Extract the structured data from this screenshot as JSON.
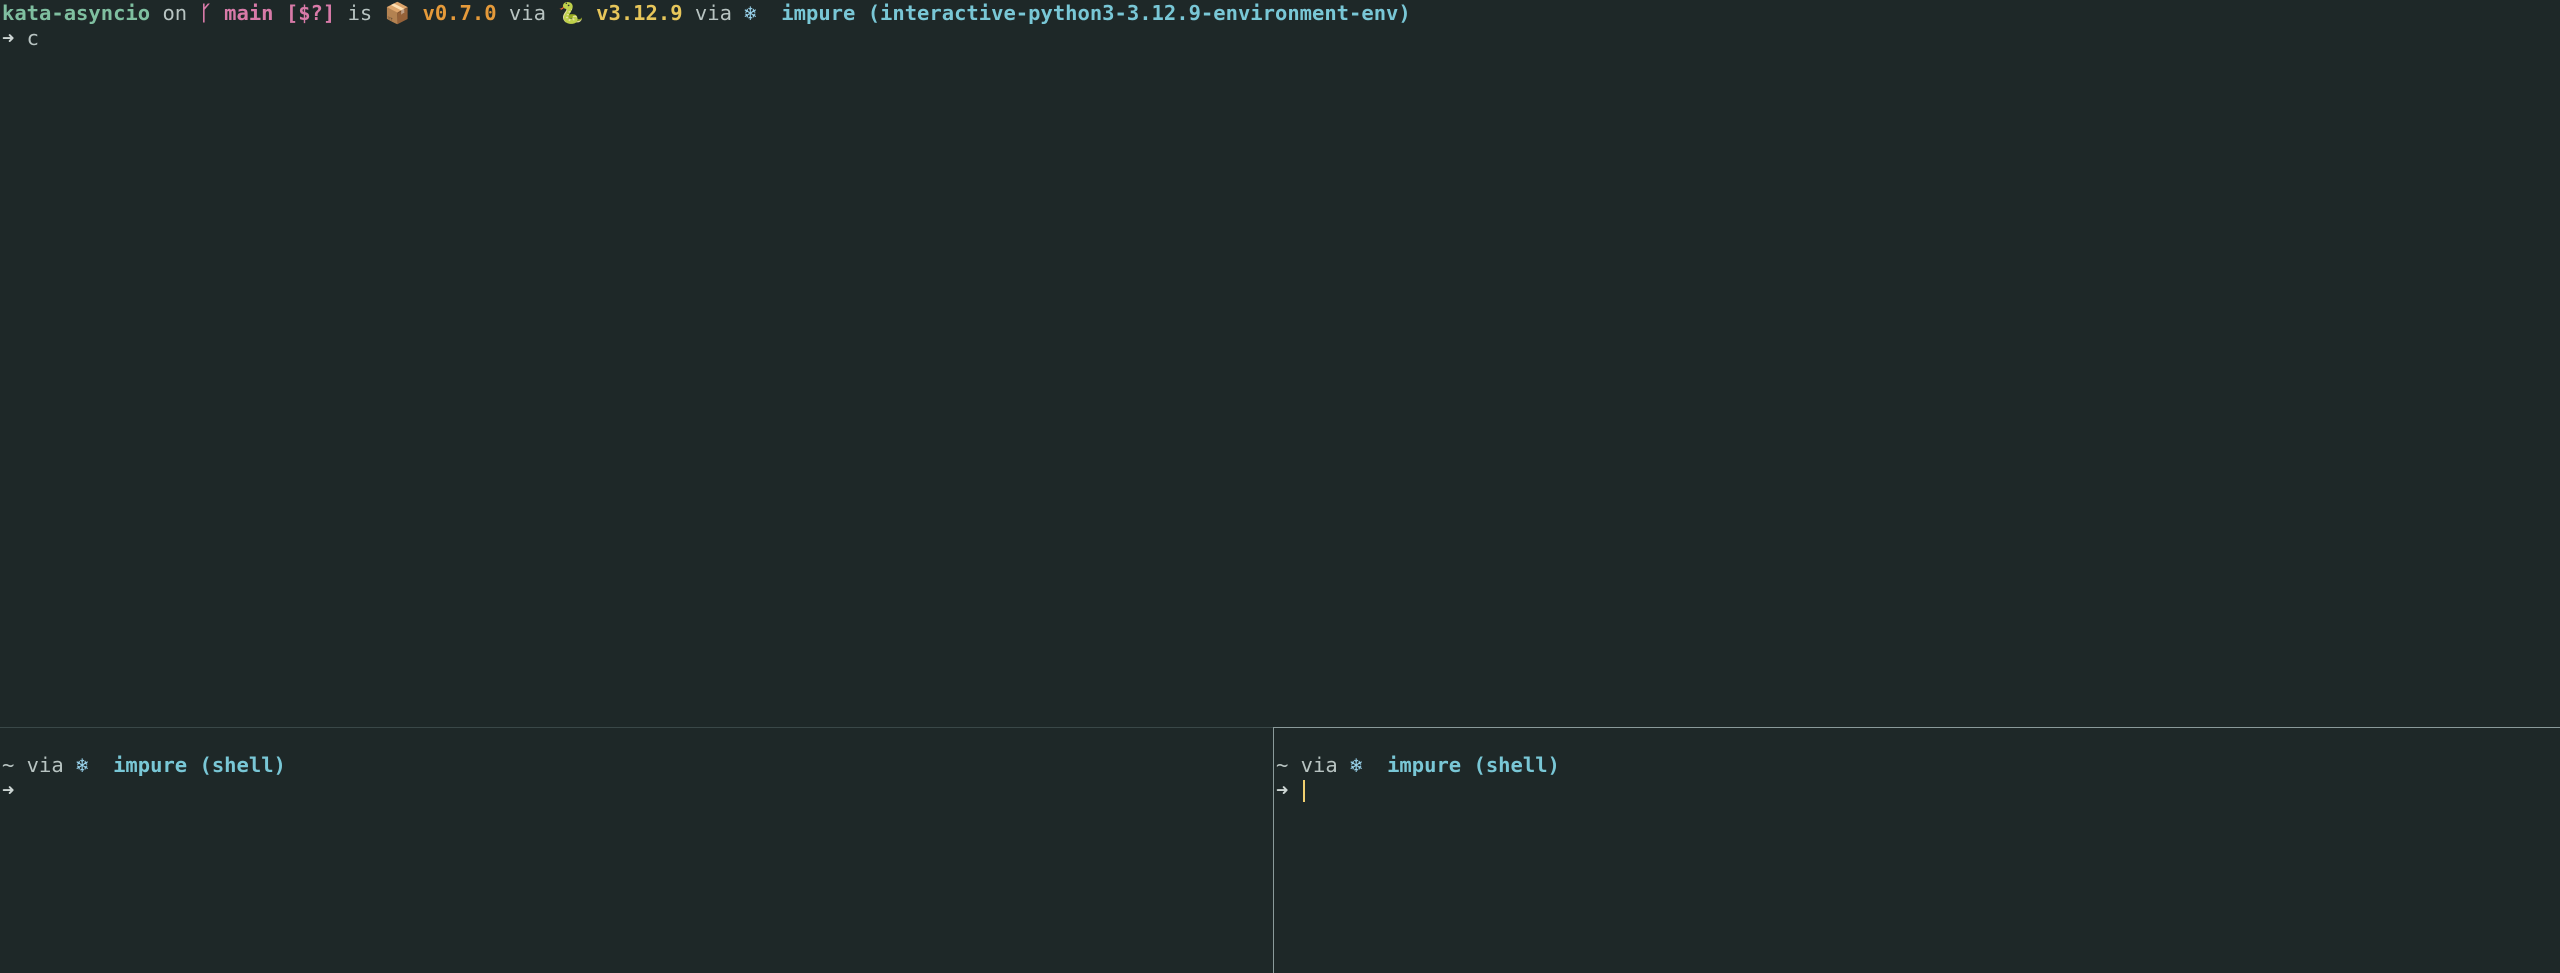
{
  "top_pane": {
    "prompt": {
      "dir": "kata-asyncio",
      "on": " on ",
      "branch_icon": "git-branch-icon",
      "branch_glyph": "ᚴ ",
      "branch": "main",
      "branch_status": " [$?]",
      "is": " is ",
      "package_icon": "package-icon",
      "package_glyph": "📦",
      "package_version": " v0.7.0",
      "via1": " via ",
      "python_icon": "python-icon",
      "python_glyph": "🐍",
      "python_version": " v3.12.9",
      "via2": " via ",
      "nix_icon": "nix-snowflake-icon",
      "nix_glyph": "❄",
      "nix_text": "  impure (interactive-python3-3.12.9-environment-env)"
    },
    "input_arrow": "➜",
    "input_text": " c"
  },
  "bottom_left_pane": {
    "prompt": {
      "dir": "~",
      "via": " via ",
      "nix_icon": "nix-snowflake-icon",
      "nix_glyph": "❄",
      "nix_text": "  impure (shell)"
    },
    "input_arrow": "➜",
    "input_text": ""
  },
  "bottom_right_pane": {
    "prompt": {
      "dir": "~",
      "via": " via ",
      "nix_icon": "nix-snowflake-icon",
      "nix_glyph": "❄",
      "nix_text": "  impure (shell)"
    },
    "input_arrow": "➜",
    "input_text": "",
    "active": true
  },
  "colors": {
    "background": "#1e2828",
    "dir": "#7fbfa0",
    "branch": "#d87aa8",
    "package": "#e59a3a",
    "python": "#e7c65a",
    "nix": "#79c7d6",
    "cursor": "#f0d070"
  }
}
